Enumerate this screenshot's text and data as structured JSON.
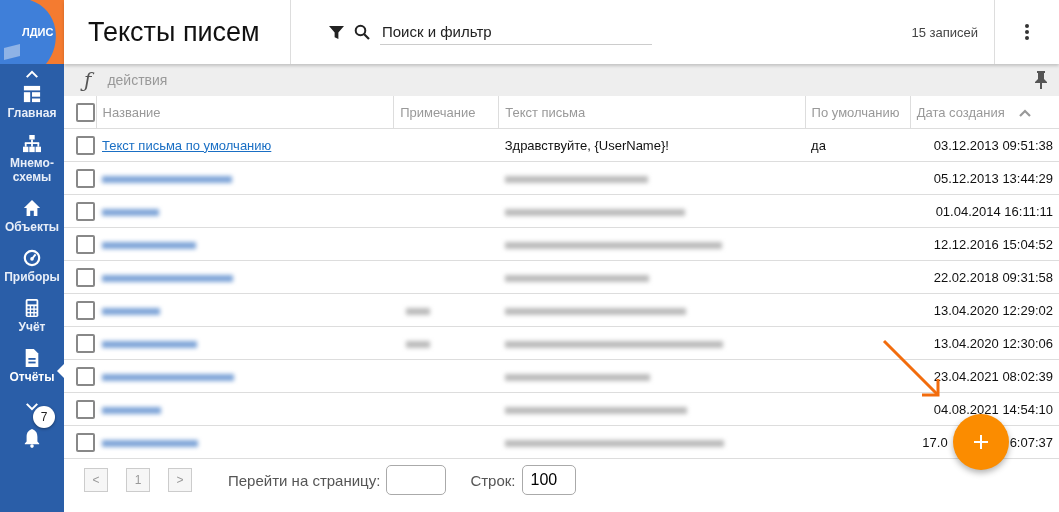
{
  "logo": {
    "text": "ЛДИС"
  },
  "header": {
    "title": "Тексты писем",
    "search": {
      "placeholder": "Поиск и фильтр"
    },
    "record_count": "15 записей"
  },
  "sidebar": {
    "items": [
      {
        "label": "Главная",
        "kind": "dashboard",
        "selected": false
      },
      {
        "label": "Мнемо-\nсхемы",
        "kind": "tree",
        "selected": false
      },
      {
        "label": "Объекты",
        "kind": "home",
        "selected": false
      },
      {
        "label": "Приборы",
        "kind": "gauge",
        "selected": false
      },
      {
        "label": "Учёт",
        "kind": "calculator",
        "selected": false
      },
      {
        "label": "Отчёты",
        "kind": "document",
        "selected": true
      }
    ],
    "notifications": {
      "badge": "7"
    }
  },
  "toolbar": {
    "function_symbol": "ƒ",
    "actions_label": "действия"
  },
  "table": {
    "all_checked": false,
    "columns": [
      "Название",
      "Примечание",
      "Текст письма",
      "По умолчанию",
      "Дата создания"
    ],
    "rows": [
      {
        "checked": false,
        "name": "Текст письма по умолчанию",
        "name_redacted": false,
        "note_redacted": false,
        "text": "Здравствуйте, {UserName}!",
        "text_redacted": false,
        "default": "да",
        "date": "03.12.2013 09:51:38"
      },
      {
        "checked": false,
        "name_redacted": true,
        "note_redacted": false,
        "text_redacted": true,
        "date": "05.12.2013 13:44:29"
      },
      {
        "checked": false,
        "name_redacted": true,
        "note_redacted": false,
        "text_redacted": true,
        "date": "01.04.2014 16:11:11"
      },
      {
        "checked": false,
        "name_redacted": true,
        "note_redacted": false,
        "text_redacted": true,
        "date": "12.12.2016 15:04:52"
      },
      {
        "checked": false,
        "name_redacted": true,
        "note_redacted": false,
        "text_redacted": true,
        "date": "22.02.2018 09:31:58"
      },
      {
        "checked": false,
        "name_redacted": true,
        "note_redacted": true,
        "text_redacted": true,
        "date": "13.04.2020 12:29:02"
      },
      {
        "checked": false,
        "name_redacted": true,
        "note_redacted": true,
        "text_redacted": true,
        "date": "13.04.2020 12:30:06"
      },
      {
        "checked": false,
        "name_redacted": true,
        "note_redacted": false,
        "text_redacted": true,
        "date": "23.04.2021 08:02:39"
      },
      {
        "checked": false,
        "name_redacted": true,
        "note_redacted": false,
        "text_redacted": true,
        "date": "04.08.2021 14:54:10"
      },
      {
        "checked": false,
        "name_redacted": true,
        "note_redacted": false,
        "text_redacted": true,
        "date": "17.0",
        "date_end": "6:07:37"
      }
    ]
  },
  "pagination": {
    "prev": "<",
    "page": "1",
    "next": ">",
    "goto_label": "Перейти на страницу:",
    "rows_label": "Строк:",
    "rows_value": "100"
  },
  "annotation_arrow": true
}
